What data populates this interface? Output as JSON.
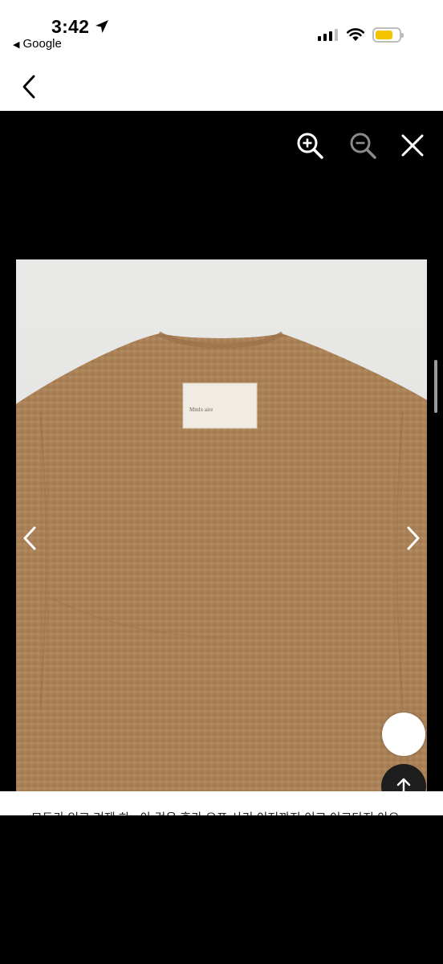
{
  "status_bar": {
    "time": "3:42",
    "back_app": "Google",
    "battery_color": "#f5c400"
  },
  "nav": {
    "back_icon": "chevron-left-icon"
  },
  "viewer": {
    "zoom_in_icon": "zoom-in-icon",
    "zoom_out_icon": "zoom-out-icon",
    "close_icon": "close-icon"
  },
  "photo": {
    "description_icon": "product-photo",
    "label_text": "Mmlx  aire"
  },
  "controls": {
    "prev_icon": "chevron-left-icon",
    "next_icon": "chevron-right-icon",
    "scroll_top_icon": "arrow-up-icon"
  },
  "caption": {
    "text": "<모두가 입고 겨제 하> 아 것은  후가 오프 사기 이저까지 이고 이크다지 아오"
  }
}
